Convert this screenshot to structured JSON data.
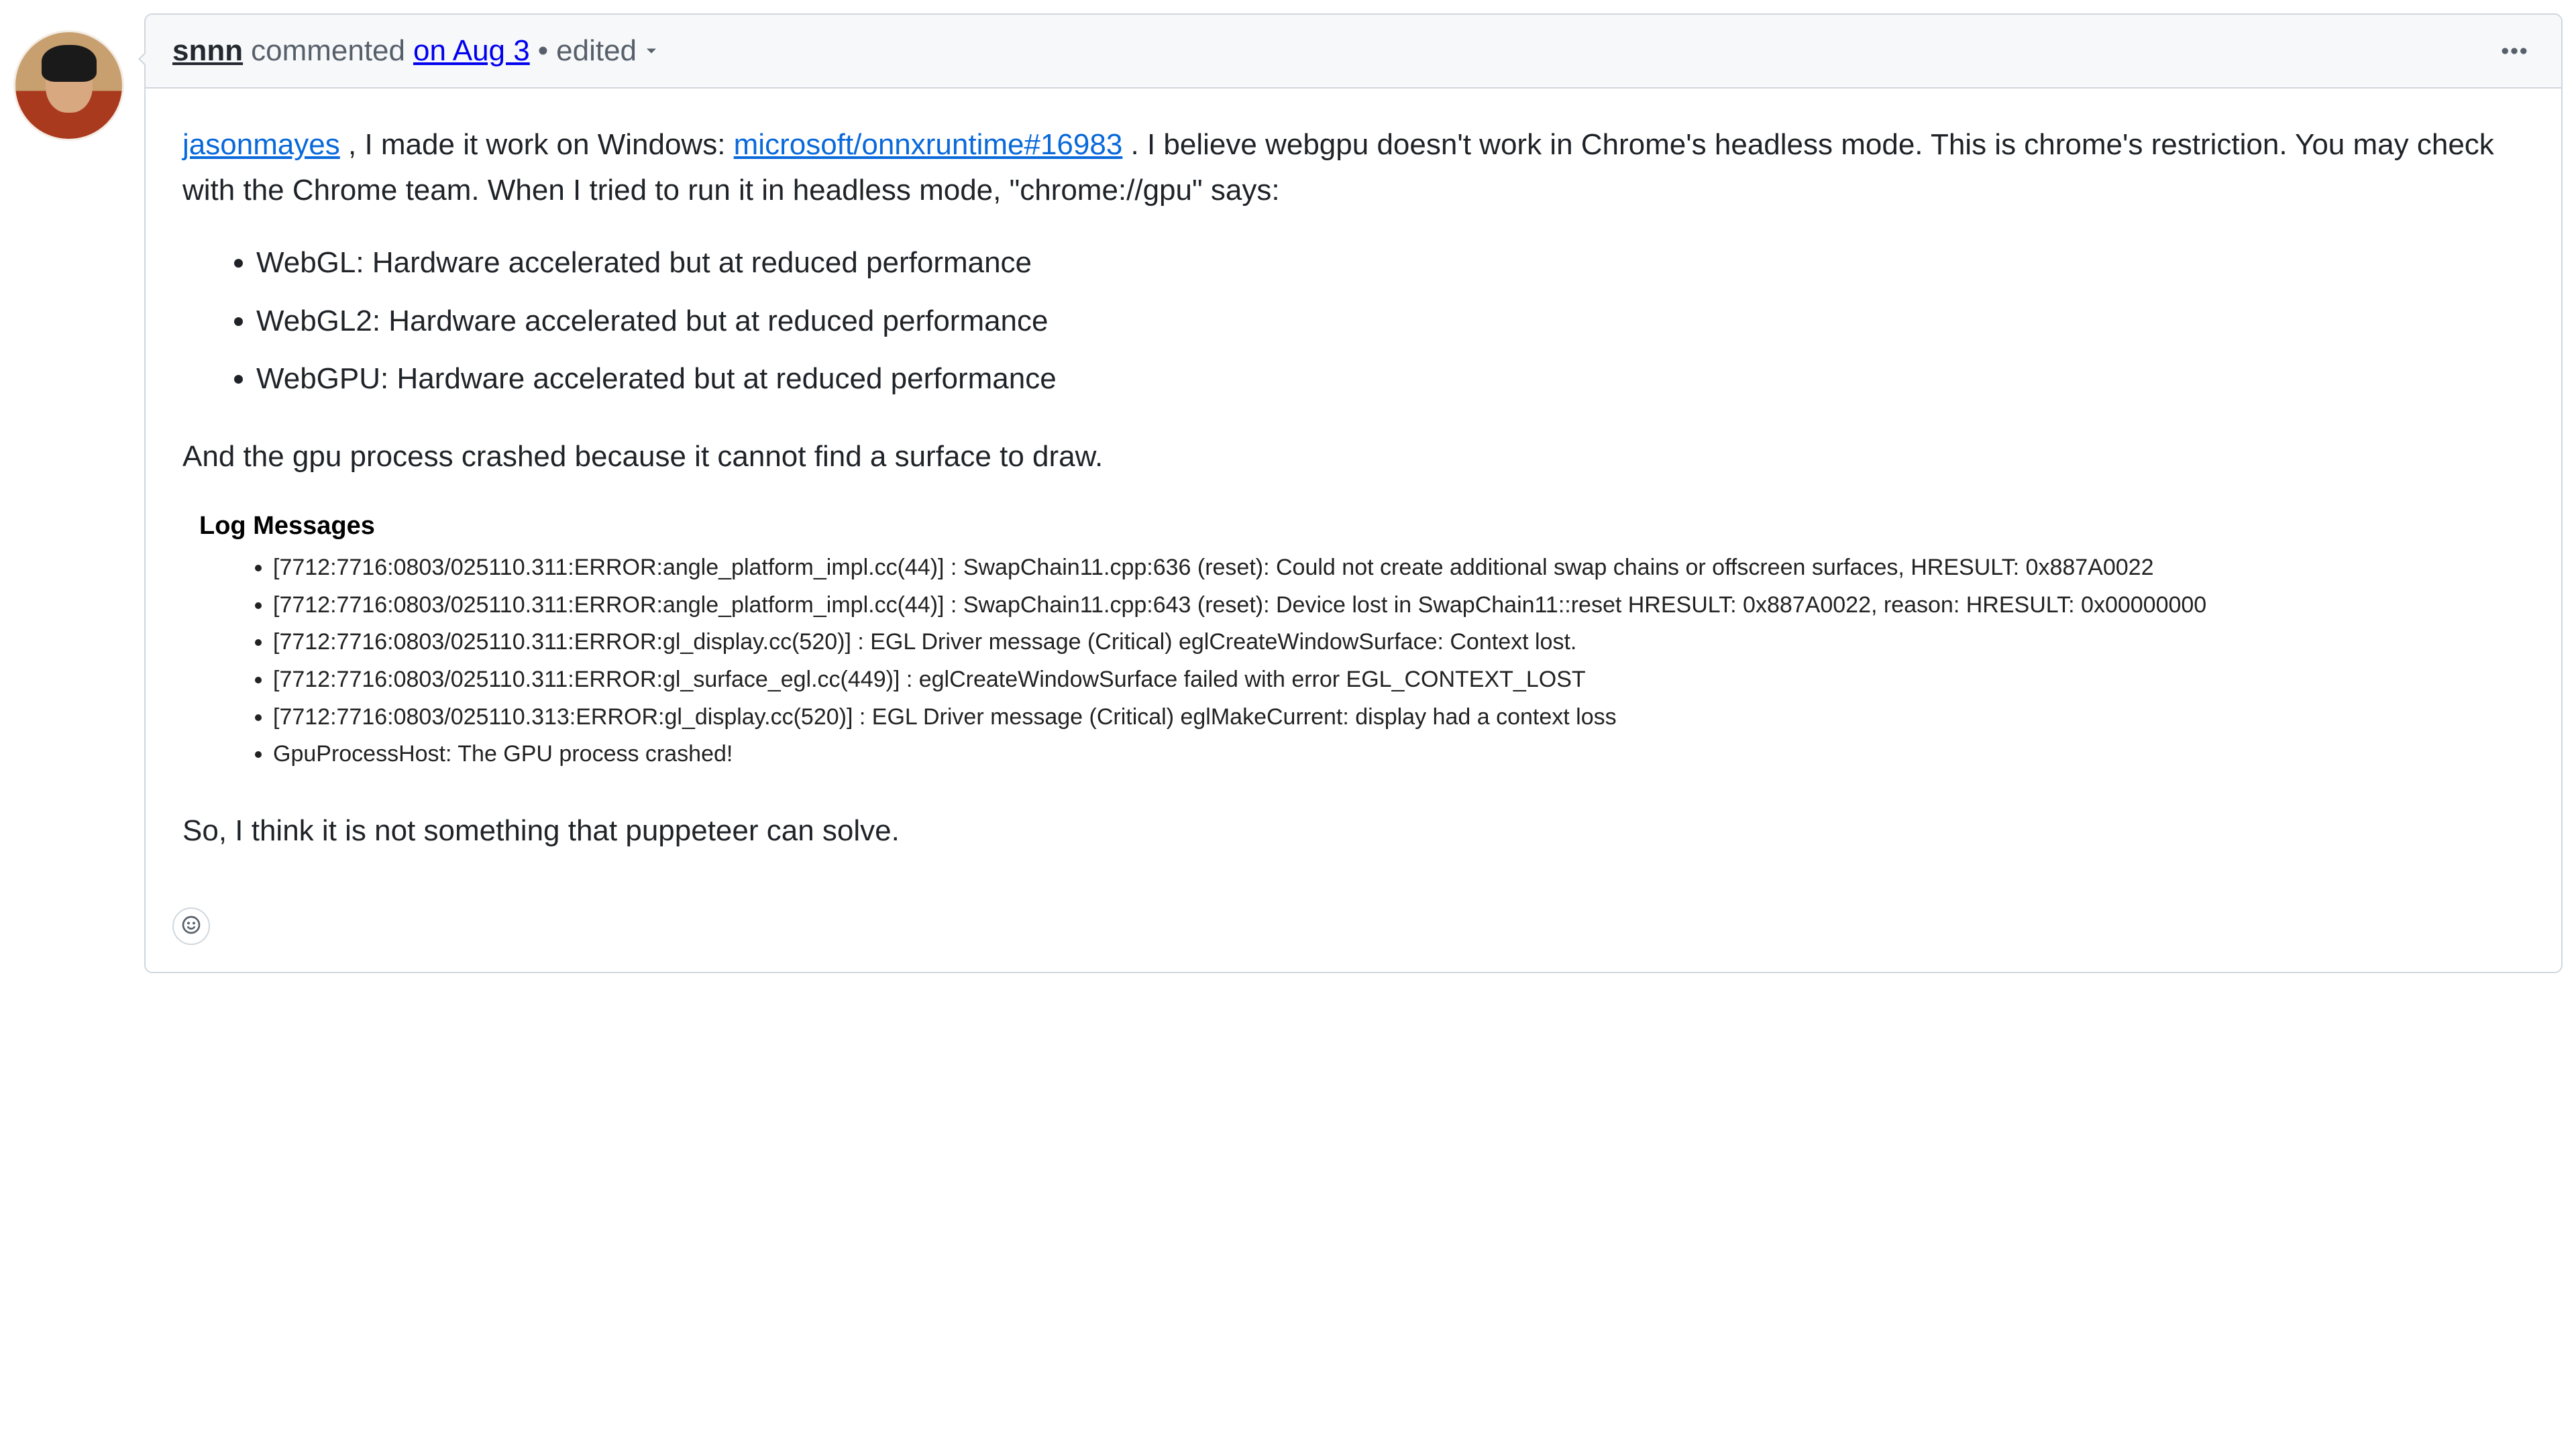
{
  "comment": {
    "author": "snnn",
    "action_prefix": " commented ",
    "timestamp": "on Aug 3",
    "separator": " • ",
    "edited_label": "edited",
    "body": {
      "mention": "jasonmayes",
      "seg1": " , I made it work on Windows: ",
      "issue_link": "microsoft/onnxruntime#16983",
      "seg2": " . I believe webgpu doesn't work in Chrome's headless mode. This is chrome's restriction. You may check with the Chrome team. When I tried to run it in headless mode, \"chrome://gpu\" says:",
      "bullets": [
        "WebGL: Hardware accelerated but at reduced performance",
        "WebGL2: Hardware accelerated but at reduced performance",
        "WebGPU: Hardware accelerated but at reduced performance"
      ],
      "para2": "And the gpu process crashed because it cannot find a surface to draw.",
      "log_title": "Log Messages",
      "log_lines": [
        "[7712:7716:0803/025110.311:ERROR:angle_platform_impl.cc(44)] : SwapChain11.cpp:636 (reset): Could not create additional swap chains or offscreen surfaces, HRESULT: 0x887A0022",
        "[7712:7716:0803/025110.311:ERROR:angle_platform_impl.cc(44)] : SwapChain11.cpp:643 (reset): Device lost in SwapChain11::reset HRESULT: 0x887A0022, reason: HRESULT: 0x00000000",
        "[7712:7716:0803/025110.311:ERROR:gl_display.cc(520)] : EGL Driver message (Critical) eglCreateWindowSurface: Context lost.",
        "[7712:7716:0803/025110.311:ERROR:gl_surface_egl.cc(449)] : eglCreateWindowSurface failed with error EGL_CONTEXT_LOST",
        "[7712:7716:0803/025110.313:ERROR:gl_display.cc(520)] : EGL Driver message (Critical) eglMakeCurrent: display had a context loss",
        "GpuProcessHost: The GPU process crashed!"
      ],
      "para3": "So, I think it is not something that puppeteer can solve."
    }
  }
}
